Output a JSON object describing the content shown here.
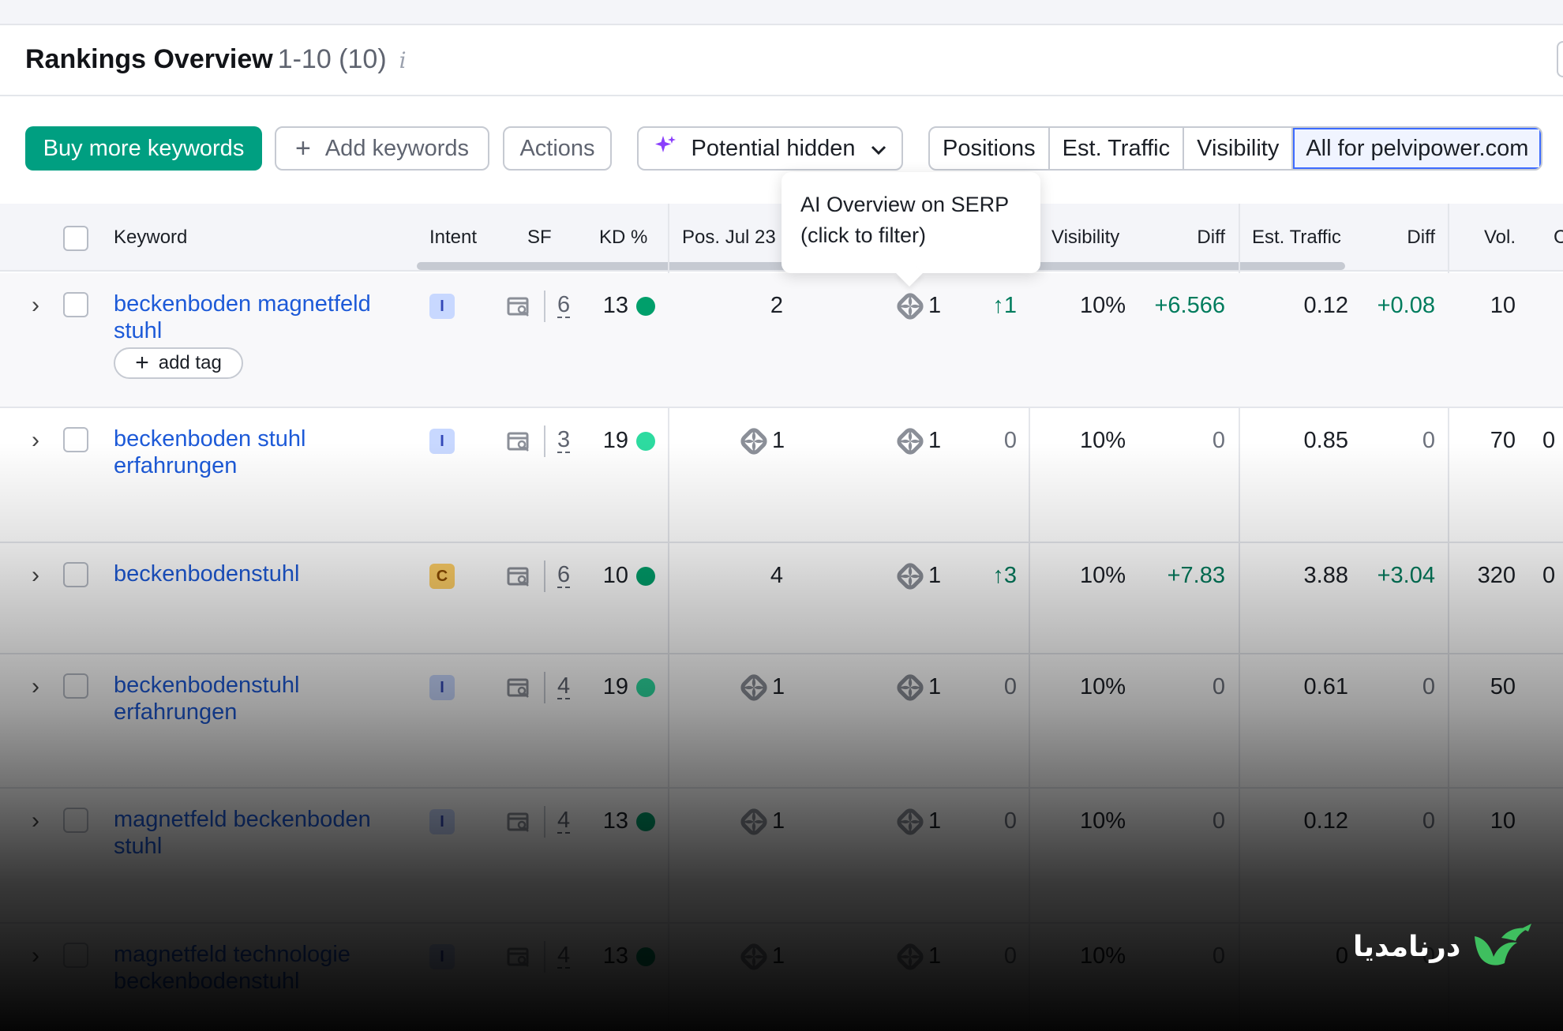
{
  "header": {
    "title": "Rankings Overview",
    "range": "1-10 (10)",
    "info_glyph": "i"
  },
  "toolbar": {
    "buy_label": "Buy more keywords",
    "add_label": "Add keywords",
    "actions_label": "Actions",
    "potential_label": "Potential hidden",
    "segments": [
      "Positions",
      "Est. Traffic",
      "Visibility",
      "All for pelvipower.com"
    ],
    "active_segment": "All for pelvipower.com"
  },
  "columns": {
    "keyword": "Keyword",
    "intent": "Intent",
    "sf": "SF",
    "kd": "KD %",
    "pos": "Pos. Jul 23",
    "visibility": "Visibility",
    "diff1": "Diff",
    "traffic": "Est. Traffic",
    "diff2": "Diff",
    "vol": "Vol.",
    "cut": "C"
  },
  "tooltip": {
    "line1": "AI Overview on SERP",
    "line2": "(click to filter)"
  },
  "row_actions": {
    "add_tag": "add tag"
  },
  "rows": [
    {
      "keyword": "beckenboden magnetfeld stuhl",
      "intent": "I",
      "sf": "6",
      "kd": "13",
      "kd_color": "#009f6b",
      "pos_prev": "2",
      "pos_prev_aio": false,
      "pos_cur": "1",
      "change": "1",
      "change_dir": "up",
      "visibility": "10%",
      "vis_diff": "+6.566",
      "traffic": "0.12",
      "traffic_diff": "+0.08",
      "vol": "10",
      "extra": ""
    },
    {
      "keyword": "beckenboden stuhl erfahrungen",
      "intent": "I",
      "sf": "3",
      "kd": "19",
      "kd_color": "#2ddba0",
      "pos_prev": "1",
      "pos_prev_aio": true,
      "pos_cur": "1",
      "change": "0",
      "change_dir": "none",
      "visibility": "10%",
      "vis_diff": "0",
      "traffic": "0.85",
      "traffic_diff": "0",
      "vol": "70",
      "extra": "0"
    },
    {
      "keyword": "beckenbodenstuhl",
      "intent": "C",
      "sf": "6",
      "kd": "10",
      "kd_color": "#009f6b",
      "pos_prev": "4",
      "pos_prev_aio": false,
      "pos_cur": "1",
      "change": "3",
      "change_dir": "up",
      "visibility": "10%",
      "vis_diff": "+7.83",
      "traffic": "3.88",
      "traffic_diff": "+3.04",
      "vol": "320",
      "extra": "0"
    },
    {
      "keyword": "beckenbodenstuhl erfahrungen",
      "intent": "I",
      "sf": "4",
      "kd": "19",
      "kd_color": "#2ddba0",
      "pos_prev": "1",
      "pos_prev_aio": true,
      "pos_cur": "1",
      "change": "0",
      "change_dir": "none",
      "visibility": "10%",
      "vis_diff": "0",
      "traffic": "0.61",
      "traffic_diff": "0",
      "vol": "50",
      "extra": ""
    },
    {
      "keyword": "magnetfeld beckenboden stuhl",
      "intent": "I",
      "sf": "4",
      "kd": "13",
      "kd_color": "#009f6b",
      "pos_prev": "1",
      "pos_prev_aio": true,
      "pos_cur": "1",
      "change": "0",
      "change_dir": "none",
      "visibility": "10%",
      "vis_diff": "0",
      "traffic": "0.12",
      "traffic_diff": "0",
      "vol": "10",
      "extra": ""
    },
    {
      "keyword": "magnetfeld technologie beckenbodenstuhl",
      "intent": "I",
      "sf": "4",
      "kd": "13",
      "kd_color": "#009f6b",
      "pos_prev": "1",
      "pos_prev_aio": true,
      "pos_cur": "1",
      "change": "0",
      "change_dir": "none",
      "visibility": "10%",
      "vis_diff": "0",
      "traffic": "0",
      "traffic_diff": "0",
      "vol": "",
      "extra": ""
    }
  ],
  "watermark": {
    "text": "درنامدیا"
  },
  "colors": {
    "brand_green": "#009f81",
    "link_blue": "#1d5ad8",
    "positive_green": "#007c5d",
    "ai_purple": "#8a3ffc"
  }
}
